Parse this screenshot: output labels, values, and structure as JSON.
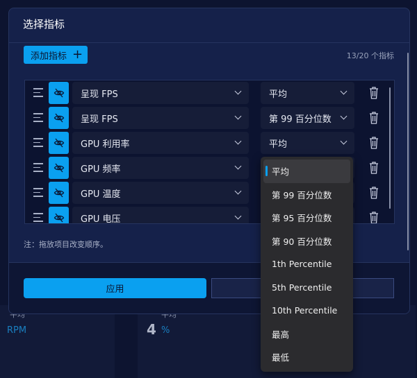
{
  "background": {
    "avg_label_1": "平均",
    "unit_rpm": "RPM",
    "value_2": "4",
    "unit_pct": "%",
    "avg_label_2": "平均"
  },
  "modal": {
    "title": "选择指标",
    "add_button": "添加指标",
    "add_icon": "plus-icon",
    "count": "13/20 个指标",
    "rows": [
      {
        "metric": "呈现 FPS",
        "stat": "平均"
      },
      {
        "metric": "呈现 FPS",
        "stat": "第 99 百分位数"
      },
      {
        "metric": "GPU 利用率",
        "stat": "平均"
      },
      {
        "metric": "GPU 频率",
        "stat": ""
      },
      {
        "metric": "GPU 温度",
        "stat": ""
      },
      {
        "metric": "GPU 电压",
        "stat": ""
      }
    ],
    "note": "注：拖放项目改变顺序。",
    "apply": "应用",
    "cancel": ""
  },
  "dropdown": {
    "selected": "平均",
    "options": [
      "平均",
      "第 99 百分位数",
      "第 95 百分位数",
      "第 90 百分位数",
      "1th Percentile",
      "5th Percentile",
      "10th Percentile",
      "最高",
      "最低"
    ]
  },
  "colors": {
    "accent": "#0aa0f0",
    "modal_bg": "#15214a",
    "dropdown_bg": "#2b2b2e"
  }
}
